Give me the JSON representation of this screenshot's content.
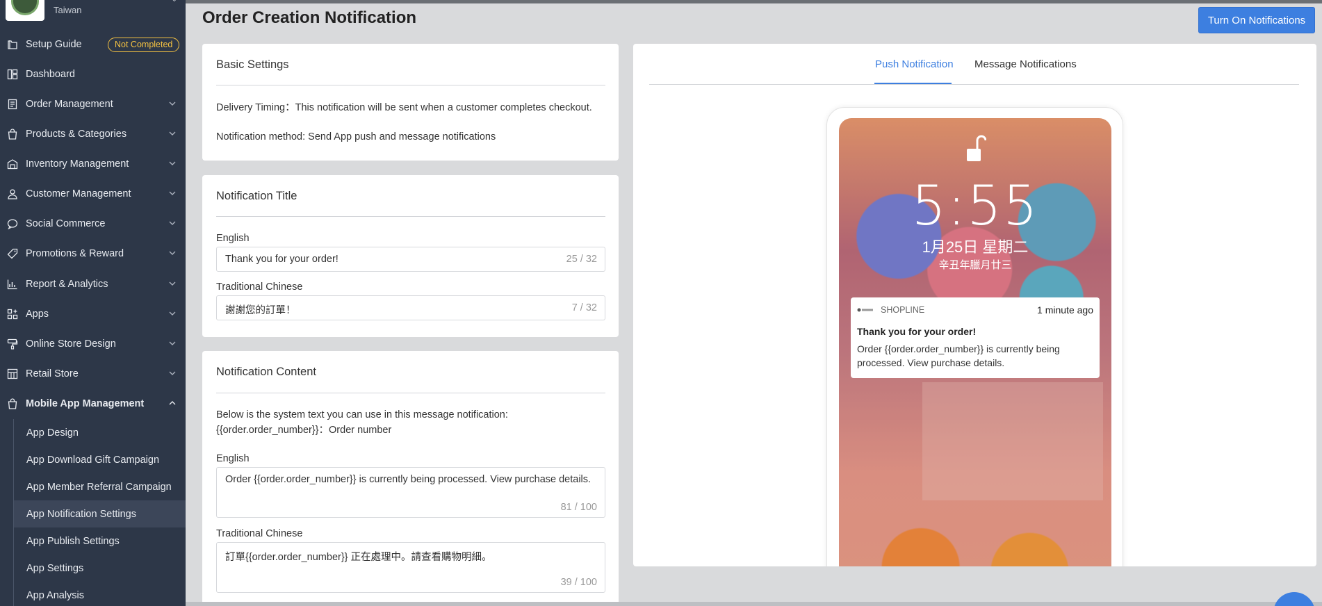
{
  "store": {
    "name": "Taiwan"
  },
  "sidebar": {
    "setup_guide": {
      "label": "Setup Guide",
      "badge": "Not Completed"
    },
    "items": [
      {
        "label": "Dashboard",
        "icon": "dashboard-icon"
      },
      {
        "label": "Order Management",
        "icon": "order-icon"
      },
      {
        "label": "Products & Categories",
        "icon": "bag-icon"
      },
      {
        "label": "Inventory Management",
        "icon": "inventory-icon"
      },
      {
        "label": "Customer Management",
        "icon": "user-icon"
      },
      {
        "label": "Social Commerce",
        "icon": "chat-icon"
      },
      {
        "label": "Promotions & Reward",
        "icon": "tag-icon"
      },
      {
        "label": "Report & Analytics",
        "icon": "chart-icon"
      },
      {
        "label": "Apps",
        "icon": "apps-icon"
      },
      {
        "label": "Online Store Design",
        "icon": "paint-icon"
      },
      {
        "label": "Retail Store",
        "icon": "store-icon"
      },
      {
        "label": "Mobile App Management",
        "icon": "mobile-bag-icon"
      }
    ],
    "sub_items": [
      {
        "label": "App Design"
      },
      {
        "label": "App Download Gift Campaign"
      },
      {
        "label": "App Member Referral Campaign"
      },
      {
        "label": "App Notification Settings"
      },
      {
        "label": "App Publish Settings"
      },
      {
        "label": "App Settings"
      },
      {
        "label": "App Analysis"
      }
    ]
  },
  "header": {
    "title": "Order Creation Notification",
    "primary_button": "Turn On Notifications"
  },
  "basic_settings": {
    "title": "Basic Settings",
    "delivery_timing": "Delivery Timing：This notification will be sent when a customer completes checkout.",
    "method": "Notification method: Send App push and message notifications"
  },
  "notification_title": {
    "title": "Notification Title",
    "english_label": "English",
    "english_value": "Thank you for your order!",
    "english_count": "25 / 32",
    "chinese_label": "Traditional Chinese",
    "chinese_value": "謝謝您的訂單！",
    "chinese_count": "7 / 32"
  },
  "notification_content": {
    "title": "Notification Content",
    "help_line1": "Below is the system text you can use in this message notification:",
    "help_line2": "{{order.order_number}}：Order number",
    "english_label": "English",
    "english_value": "Order {{order.order_number}} is currently being processed. View purchase details.",
    "english_count": "81 / 100",
    "chinese_label": "Traditional Chinese",
    "chinese_value": "訂單{{order.order_number}} 正在處理中。請查看購物明細。",
    "chinese_count": "39 / 100"
  },
  "preview": {
    "tabs": [
      {
        "label": "Push Notification",
        "active": true
      },
      {
        "label": "Message Notifications",
        "active": false
      }
    ],
    "lock_screen": {
      "time": "5:55",
      "date": "1月25日 星期二",
      "lunar": "辛丑年臘月廿三"
    },
    "notification": {
      "app_name": "SHOPLINE",
      "time": "1 minute ago",
      "title": "Thank you for your order!",
      "body": "Order {{order.order_number}} is currently being processed. View purchase details."
    }
  },
  "colors": {
    "sidebar_bg": "#2d3748",
    "accent": "#3d7fe0",
    "badge": "#f5c242"
  }
}
